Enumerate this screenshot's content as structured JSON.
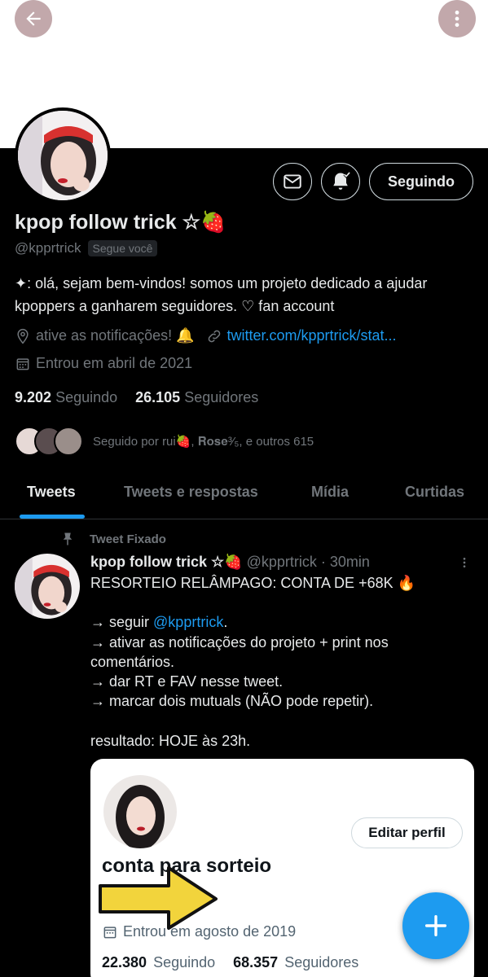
{
  "profile": {
    "display_name": "kpop follow trick ☆🍓",
    "handle": "@kpprtrick",
    "follows_you": "Segue você",
    "bio_line1": "✦: olá, sejam bem-vindos! somos um projeto dedicado a ajudar",
    "bio_line2": "kpoppers a ganharem seguidores. ♡ fan account",
    "location": "ative as notificações! 🔔",
    "website": "twitter.com/kpprtrick/stat...",
    "joined": "Entrou em abril de 2021",
    "following_count": "9.202",
    "following_label": "Seguindo",
    "followers_count": "26.105",
    "followers_label": "Seguidores",
    "followed_by": "Seguido por rui🍓, 𝐑𝐨𝐬𝐞³⁄₅, e outros 615",
    "follow_button": "Seguindo"
  },
  "tabs": [
    {
      "label": "Tweets"
    },
    {
      "label": "Tweets e respostas"
    },
    {
      "label": "Mídia"
    },
    {
      "label": "Curtidas"
    }
  ],
  "pinned_tweet": {
    "pinned_label": "Tweet Fixado",
    "author_name": "kpop follow trick ☆🍓",
    "author_handle": "@kpprtrick",
    "time": "· 30min",
    "lines": {
      "l1": "RESORTEIO RELÂMPAGO: CONTA DE +68K 🔥",
      "l2": "",
      "l3_prefix": "→ seguir ",
      "l3_mention": "@kpprtrick",
      "l3_suffix": ".",
      "l4": "→ ativar as notificações do projeto + print nos",
      "l5": "comentários.",
      "l6": "→ dar RT e FAV nesse tweet.",
      "l7": "→ marcar dois mutuals (NÃO pode repetir).",
      "l8": "",
      "l9": "resultado: HOJE às 23h."
    }
  },
  "card": {
    "edit_button": "Editar perfil",
    "name": "conta para sorteio",
    "joined": "Entrou em agosto de 2019",
    "following_count": "22.380",
    "following_label": "Seguindo",
    "followers_count": "68.357",
    "followers_label": "Seguidores"
  },
  "colors": {
    "accent": "#1d9bf0",
    "background": "#000000",
    "button_overlay": "#c2a8ab",
    "arrow_yellow": "#f2d43c"
  },
  "icons": [
    "back-arrow-icon",
    "more-vertical-icon",
    "mail-icon",
    "bell-check-icon",
    "location-icon",
    "link-icon",
    "calendar-icon",
    "pin-icon",
    "plus-icon"
  ]
}
